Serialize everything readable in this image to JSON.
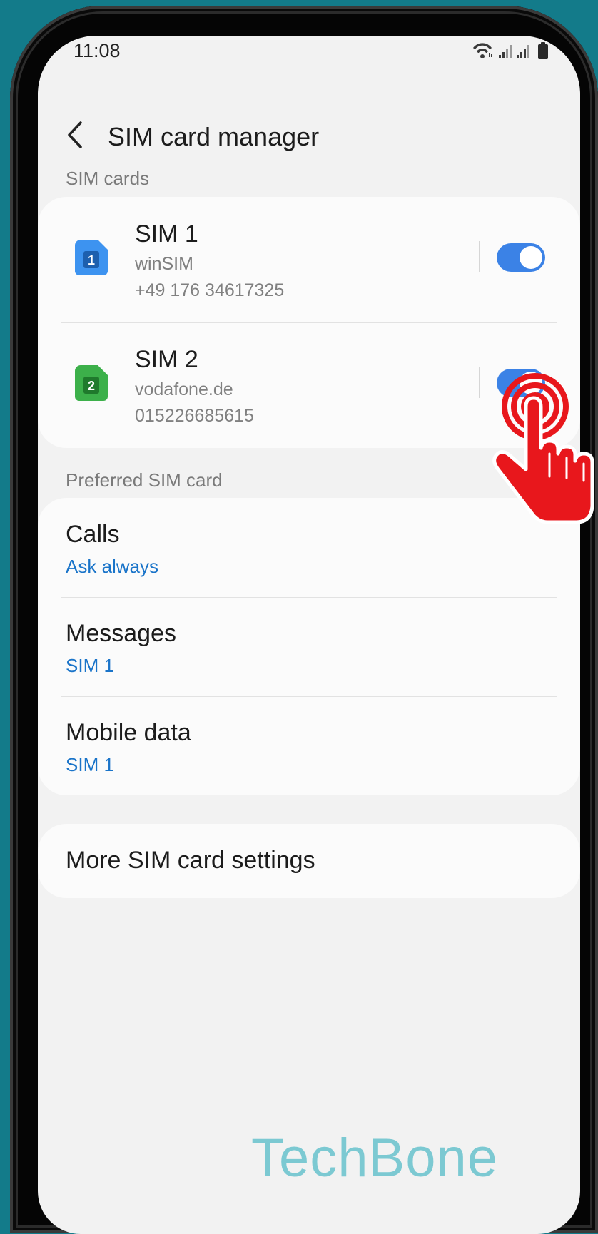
{
  "status_bar": {
    "time": "11:08"
  },
  "app_bar": {
    "title": "SIM card manager"
  },
  "sim_section": {
    "label": "SIM cards",
    "sims": [
      {
        "name": "SIM 1",
        "carrier": "winSIM",
        "number": "+49 176 34617325",
        "icon_label": "1",
        "icon_color": "#3d93f0",
        "enabled": true
      },
      {
        "name": "SIM 2",
        "carrier": "vodafone.de",
        "number": "015226685615",
        "icon_label": "2",
        "icon_color": "#3cb04a",
        "enabled": true
      }
    ]
  },
  "preferred_section": {
    "label": "Preferred SIM card",
    "items": [
      {
        "title": "Calls",
        "value": "Ask always"
      },
      {
        "title": "Messages",
        "value": "SIM 1"
      },
      {
        "title": "Mobile data",
        "value": "SIM 1"
      }
    ]
  },
  "more_settings": {
    "title": "More SIM card settings"
  },
  "watermark": "TechBone",
  "colors": {
    "accent": "#3b82e6",
    "link": "#1a74c9",
    "tap_indicator": "#e8171c"
  }
}
